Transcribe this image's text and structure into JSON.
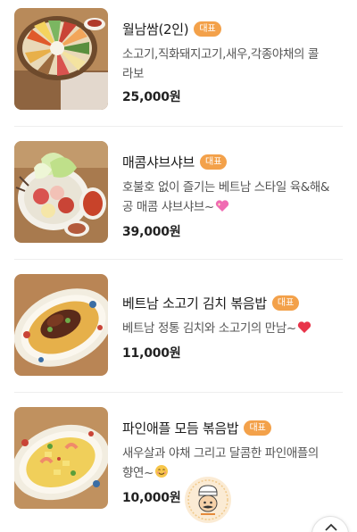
{
  "menu": {
    "items": [
      {
        "name": "월남쌈(2인)",
        "badge": "대표",
        "desc_line1": "소고기,직화돼지고기,새우,각종야채의 콜",
        "desc_line2": "라보",
        "price": "25,000원"
      },
      {
        "name": "매콤샤브샤브",
        "badge": "대표",
        "desc_line1": "호불호 없이 즐기는 베트남 스타일 육&해&",
        "desc_line2": "공 매콤 샤브샤브~",
        "desc_emoji": "sparkling-heart",
        "price": "39,000원"
      },
      {
        "name": "베트남 소고기 김치 볶음밥",
        "badge": "대표",
        "desc_line1": "베트남 정통 김치와 소고기의 만남~",
        "desc_emoji": "red-heart",
        "price": "11,000원"
      },
      {
        "name": "파인애플 모듬 볶음밥",
        "badge": "대표",
        "desc_line1": "새우살과 야채 그리고 달콤한 파인애플의",
        "desc_line2": "향연~",
        "desc_emoji": "smiling-face",
        "price": "10,000원"
      }
    ]
  },
  "colors": {
    "badge": "#f3a14a",
    "text": "#1a1a1a",
    "desc": "#555555"
  },
  "icons": {
    "watermark": "chef-mascot-logo",
    "scroll_top": "chevron-up-icon"
  }
}
